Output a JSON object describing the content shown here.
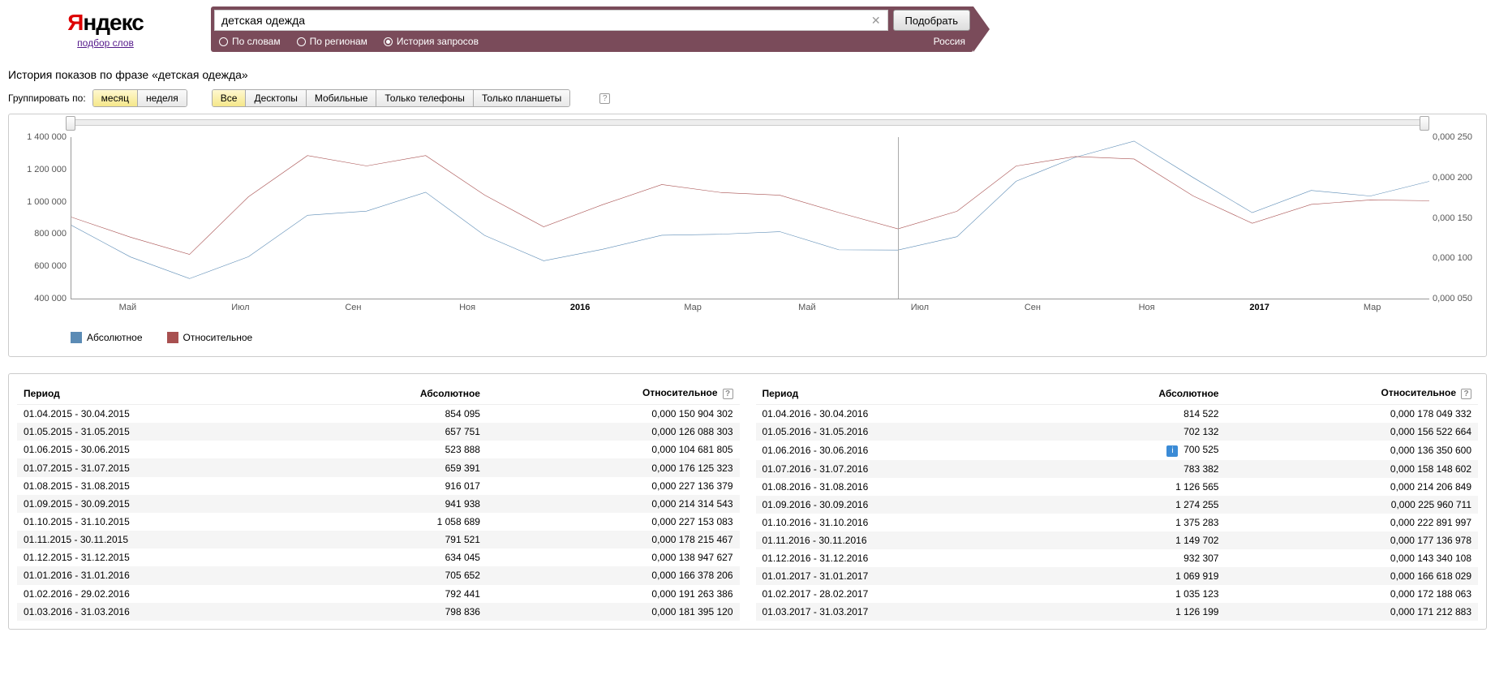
{
  "logo": {
    "y": "Я",
    "rest": "ндекс",
    "sub": "подбор слов"
  },
  "search": {
    "value": "детская одежда",
    "button": "Подобрать"
  },
  "tabs": {
    "words": "По словам",
    "regions": "По регионам",
    "history": "История запросов"
  },
  "region": "Россия",
  "title": "История показов по фразе «детская одежда»",
  "group_label": "Группировать по:",
  "group": {
    "month": "месяц",
    "week": "неделя"
  },
  "device": {
    "all": "Все",
    "desktop": "Десктопы",
    "mobile": "Мобильные",
    "phones": "Только телефоны",
    "tablets": "Только планшеты"
  },
  "legend": {
    "abs": "Абсолютное",
    "rel": "Относительное"
  },
  "colors": {
    "abs": "#5b8bb5",
    "rel": "#a85050"
  },
  "y_left": [
    "1 400 000",
    "1 200 000",
    "1 000 000",
    "800 000",
    "600 000",
    "400 000"
  ],
  "y_right": [
    "0,000 250",
    "0,000 200",
    "0,000 150",
    "0,000 100",
    "0,000 050"
  ],
  "x_ticks": [
    {
      "l": "Май",
      "p": 4.2,
      "b": false
    },
    {
      "l": "Июл",
      "p": 12.5,
      "b": false
    },
    {
      "l": "Сен",
      "p": 20.8,
      "b": false
    },
    {
      "l": "Ноя",
      "p": 29.2,
      "b": false
    },
    {
      "l": "2016",
      "p": 37.5,
      "b": true
    },
    {
      "l": "Мар",
      "p": 45.8,
      "b": false
    },
    {
      "l": "Май",
      "p": 54.2,
      "b": false
    },
    {
      "l": "Июл",
      "p": 62.5,
      "b": false
    },
    {
      "l": "Сен",
      "p": 70.8,
      "b": false
    },
    {
      "l": "Ноя",
      "p": 79.2,
      "b": false
    },
    {
      "l": "2017",
      "p": 87.5,
      "b": true
    },
    {
      "l": "Мар",
      "p": 95.8,
      "b": false
    }
  ],
  "headers": {
    "period": "Период",
    "abs": "Абсолютное",
    "rel": "Относительное"
  },
  "help": "?",
  "chart_data": {
    "type": "line",
    "x": [
      "Апр 2015",
      "Май 2015",
      "Июн 2015",
      "Июл 2015",
      "Авг 2015",
      "Сен 2015",
      "Окт 2015",
      "Ноя 2015",
      "Дек 2015",
      "Янв 2016",
      "Фев 2016",
      "Мар 2016",
      "Апр 2016",
      "Май 2016",
      "Июн 2016",
      "Июл 2016",
      "Авг 2016",
      "Сен 2016",
      "Окт 2016",
      "Ноя 2016",
      "Дек 2016",
      "Янв 2017",
      "Фев 2017",
      "Мар 2017"
    ],
    "series": [
      {
        "name": "Абсолютное",
        "axis": "left",
        "values": [
          854095,
          657751,
          523888,
          659391,
          916017,
          941938,
          1058689,
          791521,
          634045,
          705652,
          792441,
          798836,
          814522,
          702132,
          700525,
          783382,
          1126565,
          1274255,
          1375283,
          1149702,
          932307,
          1069919,
          1035123,
          1126199
        ]
      },
      {
        "name": "Относительное",
        "axis": "right",
        "values": [
          0.000150904302,
          0.000126088303,
          0.000104681805,
          0.000176125323,
          0.000227136379,
          0.000214314543,
          0.000227153083,
          0.000178215467,
          0.000138947627,
          0.000166378206,
          0.000191263386,
          0.00018139512,
          0.000178049332,
          0.000156522664,
          0.0001363506,
          0.000158148602,
          0.000214206849,
          0.000225960711,
          0.000222891997,
          0.000177136978,
          0.000143340108,
          0.000166618029,
          0.000172188063,
          0.000171212883
        ]
      }
    ],
    "ylim_left": [
      400000,
      1400000
    ],
    "ylim_right": [
      5e-05,
      0.00025
    ],
    "xlabel": "",
    "ylabel": ""
  },
  "table_left": [
    {
      "p": "01.04.2015 - 30.04.2015",
      "a": "854 095",
      "r": "0,000 150 904 302"
    },
    {
      "p": "01.05.2015 - 31.05.2015",
      "a": "657 751",
      "r": "0,000 126 088 303"
    },
    {
      "p": "01.06.2015 - 30.06.2015",
      "a": "523 888",
      "r": "0,000 104 681 805"
    },
    {
      "p": "01.07.2015 - 31.07.2015",
      "a": "659 391",
      "r": "0,000 176 125 323"
    },
    {
      "p": "01.08.2015 - 31.08.2015",
      "a": "916 017",
      "r": "0,000 227 136 379"
    },
    {
      "p": "01.09.2015 - 30.09.2015",
      "a": "941 938",
      "r": "0,000 214 314 543"
    },
    {
      "p": "01.10.2015 - 31.10.2015",
      "a": "1 058 689",
      "r": "0,000 227 153 083"
    },
    {
      "p": "01.11.2015 - 30.11.2015",
      "a": "791 521",
      "r": "0,000 178 215 467"
    },
    {
      "p": "01.12.2015 - 31.12.2015",
      "a": "634 045",
      "r": "0,000 138 947 627"
    },
    {
      "p": "01.01.2016 - 31.01.2016",
      "a": "705 652",
      "r": "0,000 166 378 206"
    },
    {
      "p": "01.02.2016 - 29.02.2016",
      "a": "792 441",
      "r": "0,000 191 263 386"
    },
    {
      "p": "01.03.2016 - 31.03.2016",
      "a": "798 836",
      "r": "0,000 181 395 120"
    }
  ],
  "table_right": [
    {
      "p": "01.04.2016 - 30.04.2016",
      "a": "814 522",
      "r": "0,000 178 049 332"
    },
    {
      "p": "01.05.2016 - 31.05.2016",
      "a": "702 132",
      "r": "0,000 156 522 664"
    },
    {
      "p": "01.06.2016 - 30.06.2016",
      "a": "700 525",
      "r": "0,000 136 350 600",
      "info": true
    },
    {
      "p": "01.07.2016 - 31.07.2016",
      "a": "783 382",
      "r": "0,000 158 148 602"
    },
    {
      "p": "01.08.2016 - 31.08.2016",
      "a": "1 126 565",
      "r": "0,000 214 206 849"
    },
    {
      "p": "01.09.2016 - 30.09.2016",
      "a": "1 274 255",
      "r": "0,000 225 960 711"
    },
    {
      "p": "01.10.2016 - 31.10.2016",
      "a": "1 375 283",
      "r": "0,000 222 891 997"
    },
    {
      "p": "01.11.2016 - 30.11.2016",
      "a": "1 149 702",
      "r": "0,000 177 136 978"
    },
    {
      "p": "01.12.2016 - 31.12.2016",
      "a": "932 307",
      "r": "0,000 143 340 108"
    },
    {
      "p": "01.01.2017 - 31.01.2017",
      "a": "1 069 919",
      "r": "0,000 166 618 029"
    },
    {
      "p": "01.02.2017 - 28.02.2017",
      "a": "1 035 123",
      "r": "0,000 172 188 063"
    },
    {
      "p": "01.03.2017 - 31.03.2017",
      "a": "1 126 199",
      "r": "0,000 171 212 883"
    }
  ]
}
